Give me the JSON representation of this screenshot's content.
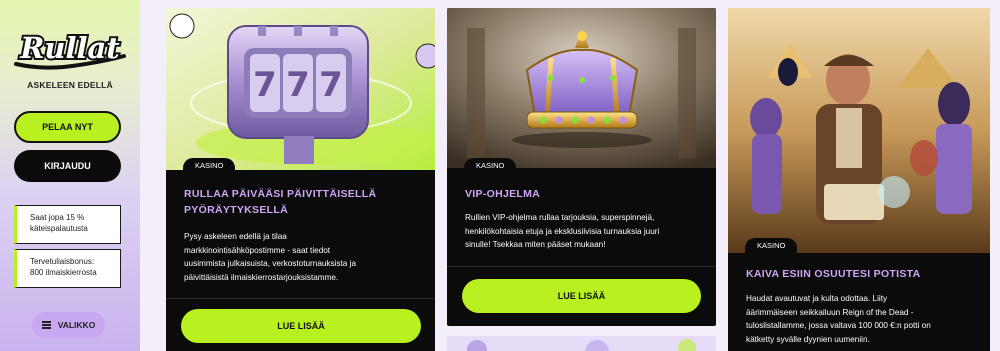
{
  "sidebar": {
    "logo_text": "Rullat",
    "tagline": "ASKELEEN EDELLÄ",
    "play_label": "PELAA NYT",
    "login_label": "KIRJAUDU",
    "promos": [
      {
        "line1": "Saat jopa 15 %",
        "line2": "käteispalautusta"
      },
      {
        "line1": "Tervetuliaisbonus:",
        "line2": "800 ilmaiskierrosta"
      }
    ],
    "menu_label": "VALIKKO",
    "menu_icon": "hamburger-icon"
  },
  "cards": [
    {
      "tag": "KASINO",
      "title_line1": "RULLAA PÄIVÄÄSI PÄIVITTÄISELLÄ",
      "title_line2": "PYÖRÄYTYKSELLÄ",
      "body_lines": [
        "Pysy askeleen edellä ja tilaa",
        "markkinointisähköpostimme - saat tiedot",
        "uusimmista julkaisuista, verkostoturnauksista ja",
        "päivittäisistä ilmaiskierrostarjouksistamme."
      ],
      "button": "LUE LISÄÄ",
      "image": "slot-machine-777"
    },
    {
      "tag": "KASINO",
      "title_line1": "VIP-OHJELMA",
      "body_lines": [
        "Rullien VIP-ohjelma rullaa tarjouksia, superspinnejä,",
        "henkilökohtaisia etuja ja eksklusiivisia turnauksia juuri",
        "sinulle! Tsekkaa miten pääset mukaan!"
      ],
      "button": "LUE LISÄÄ",
      "image": "golden-crown"
    },
    {
      "tag": "KASINO",
      "title_line1": "KAIVA ESIIN OSUUTESI POTISTA",
      "body_lines": [
        "Haudat avautuvat ja kulta odottaa. Liity",
        "äärimmäiseen seikkailuun Reign of the Dead -",
        "tuloslistallamme, jossa valtava 100 000 €:n potti on",
        "kätketty syvälle dyynien uumeniin."
      ],
      "image": "egyptian-adventurer"
    }
  ],
  "colors": {
    "accent_green": "#b8f020",
    "accent_purple": "#cfa6f5",
    "card_bg": "#0b0b0b"
  }
}
